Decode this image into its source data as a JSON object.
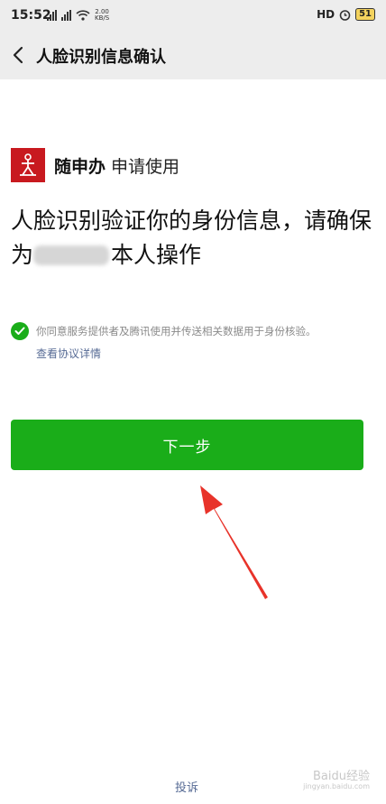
{
  "status_bar": {
    "time": "15:52",
    "speed_value": "2.00",
    "speed_unit": "KB/S",
    "hd": "HD",
    "battery": "51"
  },
  "nav": {
    "title": "人脸识别信息确认"
  },
  "app": {
    "name": "随申办",
    "apply_text": "申请使用"
  },
  "headline": {
    "part1": "人脸识别验证你的身份信息，请确保为",
    "part2": "本人操作"
  },
  "agreement": {
    "text": "你同意服务提供者及腾讯使用并传送相关数据用于身份核验。",
    "link": "查看协议详情"
  },
  "next_button": {
    "label": "下一步"
  },
  "footer": {
    "complaint": "投诉"
  },
  "watermark": {
    "main": "Baidu经验",
    "sub": "jingyan.baidu.com"
  },
  "colors": {
    "primary_green": "#1aad19",
    "link_blue": "#576b95",
    "arrow_red": "#e8332a",
    "logo_red": "#c8191f"
  }
}
